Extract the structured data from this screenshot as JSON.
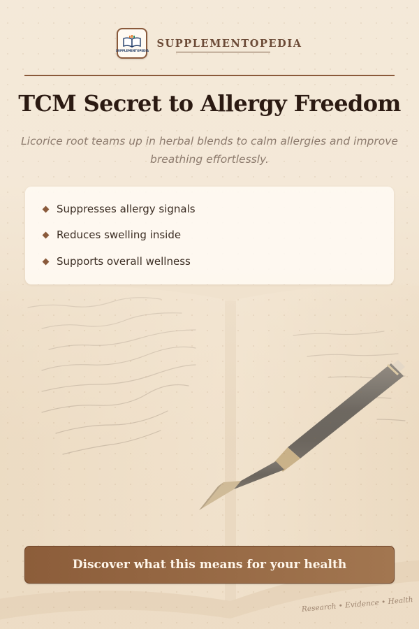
{
  "brand": {
    "logo_icon": "open-book-icon",
    "logo_text": "SUPPLEMENTOPEDIA",
    "name": "SUPPLEMENTOPEDIA"
  },
  "headline": "TCM Secret to Allergy Freedom",
  "subheadline": "Licorice root teams up in herbal blends to calm allergies and improve breathing effortlessly.",
  "benefits": [
    "Suppresses allergy signals",
    "Reduces swelling inside",
    "Supports overall wellness"
  ],
  "cta": {
    "label": "Discover what this means for your health"
  },
  "footer": {
    "tagline": "Research • Evidence • Health"
  },
  "colors": {
    "accent": "#8a5a3b",
    "title": "#2b1a12",
    "background": "#f3e6d3",
    "cta_start": "#8c5d3a",
    "cta_end": "#a27650"
  }
}
